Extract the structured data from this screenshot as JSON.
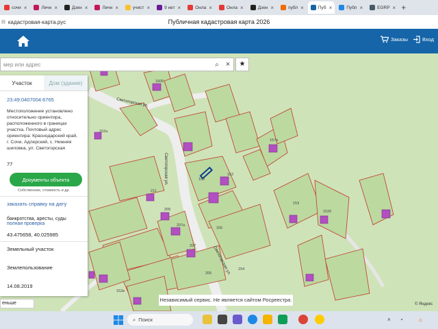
{
  "browser": {
    "tabs": [
      {
        "label": "сочи",
        "color": "#e53935"
      },
      {
        "label": "Личн",
        "color": "#c2185b"
      },
      {
        "label": "Дзен",
        "color": "#222222"
      },
      {
        "label": "Личн",
        "color": "#c2185b"
      },
      {
        "label": "учист",
        "color": "#fbc02d"
      },
      {
        "label": "9 нет",
        "color": "#6a1b9a"
      },
      {
        "label": "Онла",
        "color": "#e53935"
      },
      {
        "label": "Онла",
        "color": "#e53935"
      },
      {
        "label": "Дзен",
        "color": "#222222"
      },
      {
        "label": "публ",
        "color": "#ef6c00"
      },
      {
        "label": "Пуб",
        "color": "#1565a8",
        "active": true
      },
      {
        "label": "Публ",
        "color": "#1e88e5"
      },
      {
        "label": "EGRP",
        "color": "#455a64"
      }
    ],
    "close_glyph": "×",
    "new_tab_glyph": "+",
    "url": "кадастровая-карта.рус",
    "page_title": "Публичная кадастровая карта 2026"
  },
  "header": {
    "orders_label": "Заказы",
    "login_label": "Вход",
    "bg_color": "#1565a8"
  },
  "search": {
    "placeholder": "мер или адрес",
    "star_glyph": "★"
  },
  "panel": {
    "tab_plot": "Участок",
    "tab_building": "Дом (здание)",
    "cad_number": "23:49:0407004:6765",
    "location_text": "Местоположение установлено относительно ориентира, расположенного в границах участка. Почтовый адрес ориентира: Краснодарский край, г. Сочи, Адлерский, с. Нижняя шиловка, ул. Светогорская",
    "area": "77",
    "docs_button": "Документы объекта",
    "docs_sub": "Собственник, стоимость и др.",
    "order_link": "заказать справку на дату",
    "bankrupt_text": "банкротства, аресты, суды",
    "full_check": "полная проверка",
    "coords": "43.475658, 40.025985",
    "category": "Земельный участок",
    "usage": "Землепользование",
    "date": "14.08.2019"
  },
  "map": {
    "more_label": "еньше",
    "notice": "Независимый сервис. Не является сайтом Росреестра.",
    "attribution": "© Яндекс",
    "street_labels": [
      "Светогорская ул.",
      "Светогорская ул.",
      "Светогорская ул."
    ],
    "plot_numbers": [
      "160б",
      "152а",
      "157а",
      "211",
      "209",
      "207",
      "207а",
      "205",
      "156",
      "154",
      "150",
      "152",
      "152б",
      "153",
      "152в"
    ]
  },
  "taskbar": {
    "search_label": "Поиск"
  }
}
